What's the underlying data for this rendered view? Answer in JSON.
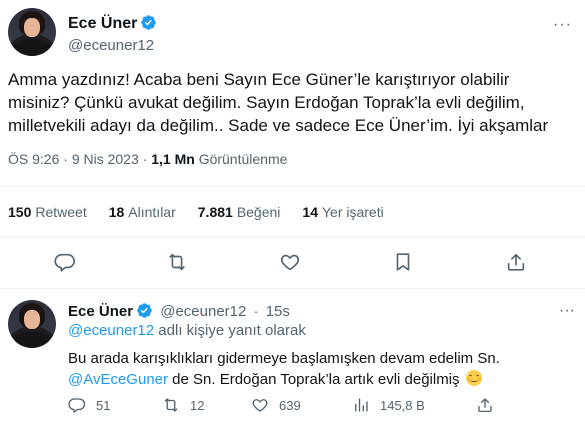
{
  "main_tweet": {
    "author_name": "Ece Üner",
    "author_handle": "@eceuner12",
    "text": "Amma yazdınız! Acaba beni Sayın Ece Güner’le karıştırıyor olabilir\nmisiniz? Çünkü avukat değilim. Sayın Erdoğan Toprak’la evli değilim,\nmilletvekili adayı da değilim.. Sade ve sadece Ece Üner’im. İyi akşamlar",
    "time": "ÖS 9:26",
    "separator": "·",
    "date": "9 Nis 2023",
    "views_count": "1,1 Mn",
    "views_label": "Görüntülenme",
    "stats": [
      {
        "count": "150",
        "label": "Retweet"
      },
      {
        "count": "18",
        "label": "Alıntılar"
      },
      {
        "count": "7.881",
        "label": "Beğeni"
      },
      {
        "count": "14",
        "label": "Yer işareti"
      }
    ],
    "more_glyph": "···"
  },
  "reply_tweet": {
    "author_name": "Ece Üner",
    "author_handle": "@eceuner12",
    "separator": "·",
    "age": "15s",
    "replying_to_handle": "@eceuner12",
    "replying_to_suffix": "adlı kişiye yanıt olarak",
    "text_line1": "Bu arada karışıklıkları gidermeye başlamışken devam edelim Sn.",
    "mention": "@AvEceGuner",
    "text_line2_rest": "de Sn. Erdoğan Toprak’la artık evli değilmiş",
    "counts": {
      "replies": "51",
      "retweets": "12",
      "likes": "639",
      "views": "145,8 B"
    },
    "more_glyph": "···"
  },
  "colors": {
    "accent": "#1d9bf0",
    "muted": "#536471",
    "text": "#0f1419",
    "divider": "#eff3f4"
  },
  "icons": [
    "verified-badge-icon",
    "reply-icon",
    "retweet-icon",
    "like-icon",
    "bookmark-icon",
    "share-icon",
    "views-icon",
    "smiling-face-emoji-icon"
  ]
}
